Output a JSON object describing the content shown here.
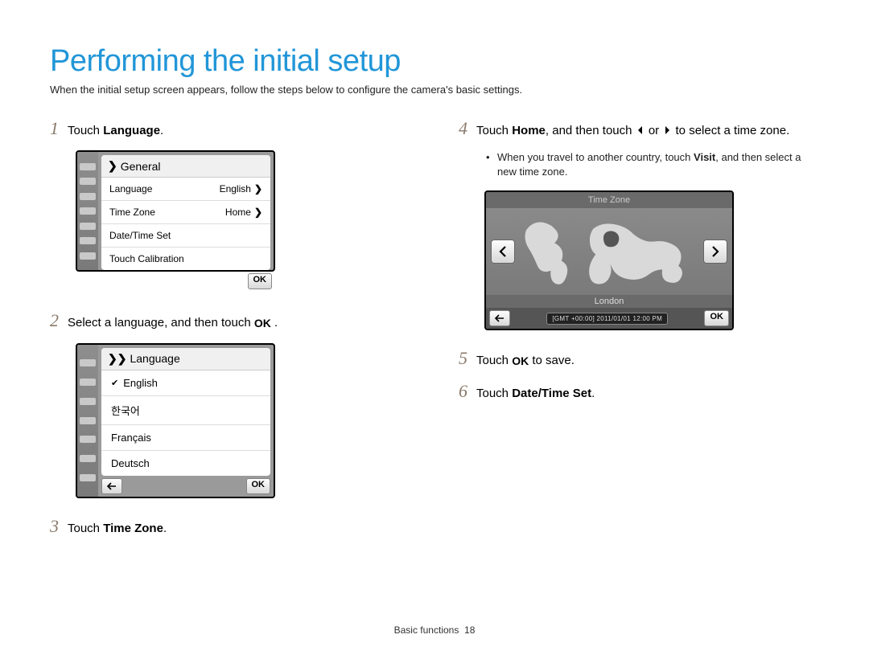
{
  "title": "Performing the initial setup",
  "subtitle": "When the initial setup screen appears, follow the steps below to configure the camera's basic settings.",
  "steps": {
    "s1": {
      "num": "1",
      "pre": "Touch ",
      "bold": "Language",
      "post": "."
    },
    "s2": {
      "num": "2",
      "pre": "Select a language, and then touch ",
      "ok": "OK",
      "post": " ."
    },
    "s3": {
      "num": "3",
      "pre": "Touch ",
      "bold": "Time Zone",
      "post": "."
    },
    "s4": {
      "num": "4",
      "pre1": "Touch ",
      "bold1": "Home",
      "mid": ", and then touch ",
      "or": " or ",
      "post": " to select a time zone."
    },
    "s4_note": {
      "pre": "When you travel to another country, touch ",
      "bold": "Visit",
      "post": ", and then select a new time zone."
    },
    "s5": {
      "num": "5",
      "pre": "Touch ",
      "ok": "OK",
      "post": " to save."
    },
    "s6": {
      "num": "6",
      "pre": "Touch ",
      "bold": "Date/Time Set",
      "post": "."
    }
  },
  "fig1": {
    "header": "General",
    "rows": [
      {
        "label": "Language",
        "value": "English",
        "chev": true
      },
      {
        "label": "Time Zone",
        "value": "Home",
        "chev": true
      },
      {
        "label": "Date/Time Set",
        "value": "",
        "chev": false
      },
      {
        "label": "Touch Calibration",
        "value": "",
        "chev": false
      }
    ],
    "ok": "OK"
  },
  "fig2": {
    "header": "Language",
    "items": [
      "English",
      "한국어",
      "Français",
      "Deutsch"
    ],
    "ok": "OK"
  },
  "fig3": {
    "title": "Time Zone",
    "city": "London",
    "info": "[GMT +00:00]   2011/01/01  12:00 PM",
    "ok": "OK"
  },
  "footer": {
    "section": "Basic functions",
    "page": "18"
  }
}
